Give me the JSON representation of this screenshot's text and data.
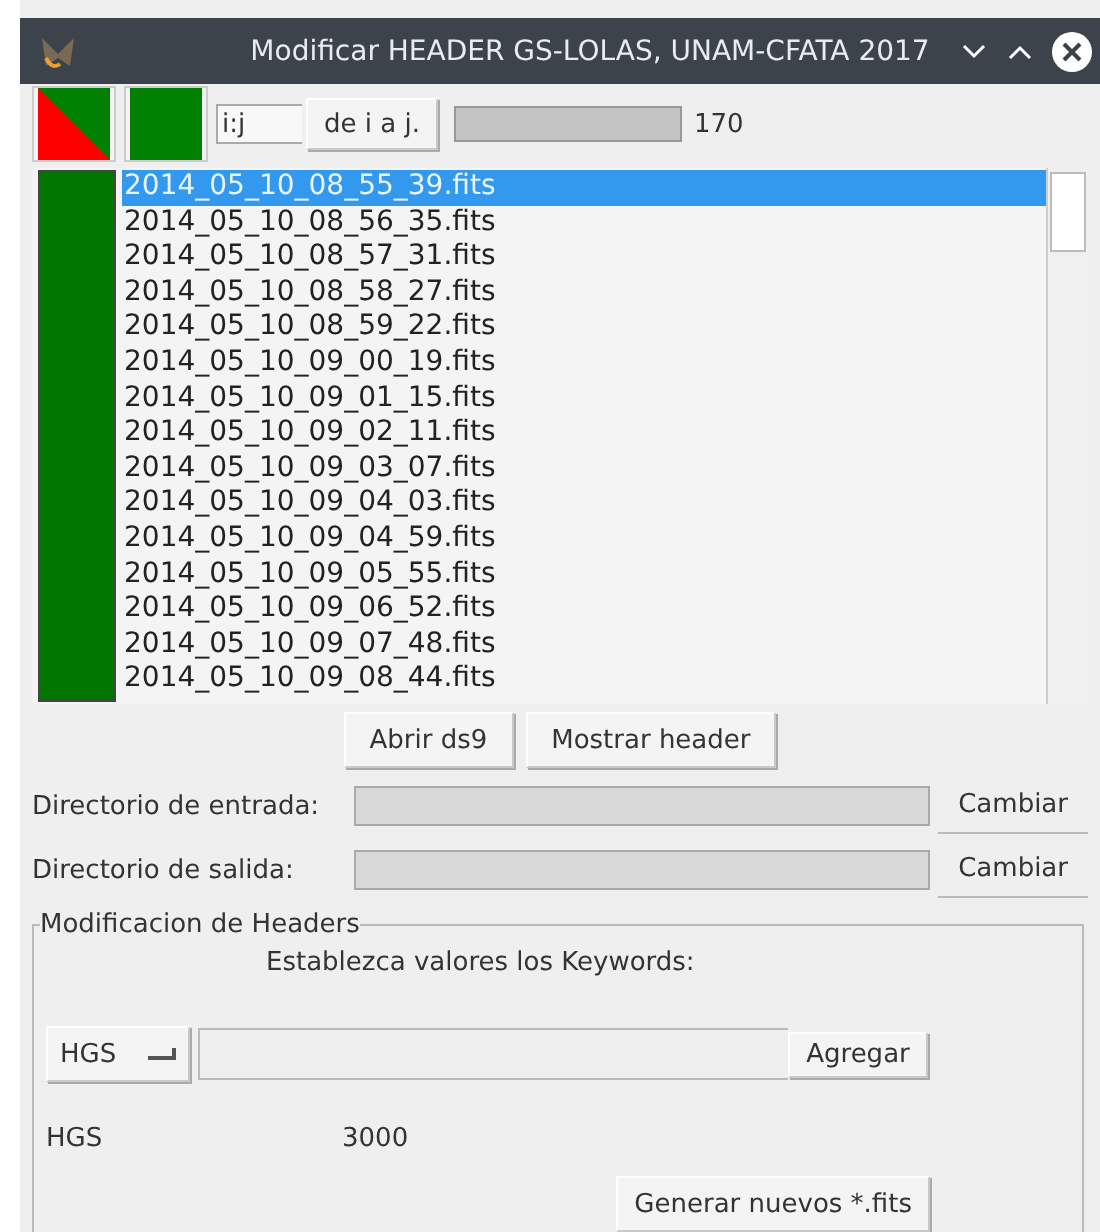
{
  "window": {
    "title": "Modificar HEADER GS-LOLAS, UNAM-CFATA 2017"
  },
  "toolbar": {
    "range_field": {
      "value": "i:j"
    },
    "range_button": "de i a j.",
    "progress": {
      "level": 1
    },
    "count": "170"
  },
  "files": [
    {
      "name": "2014_05_10_08_55_39.fits",
      "selected": true
    },
    {
      "name": "2014_05_10_08_56_35.fits",
      "selected": false
    },
    {
      "name": "2014_05_10_08_57_31.fits",
      "selected": false
    },
    {
      "name": "2014_05_10_08_58_27.fits",
      "selected": false
    },
    {
      "name": "2014_05_10_08_59_22.fits",
      "selected": false
    },
    {
      "name": "2014_05_10_09_00_19.fits",
      "selected": false
    },
    {
      "name": "2014_05_10_09_01_15.fits",
      "selected": false
    },
    {
      "name": "2014_05_10_09_02_11.fits",
      "selected": false
    },
    {
      "name": "2014_05_10_09_03_07.fits",
      "selected": false
    },
    {
      "name": "2014_05_10_09_04_03.fits",
      "selected": false
    },
    {
      "name": "2014_05_10_09_04_59.fits",
      "selected": false
    },
    {
      "name": "2014_05_10_09_05_55.fits",
      "selected": false
    },
    {
      "name": "2014_05_10_09_06_52.fits",
      "selected": false
    },
    {
      "name": "2014_05_10_09_07_48.fits",
      "selected": false
    },
    {
      "name": "2014_05_10_09_08_44.fits",
      "selected": false
    }
  ],
  "list_buttons": [
    "Abrir ds9",
    "Mostrar header"
  ],
  "directories": [
    {
      "label": "Directorio de entrada:",
      "button": "Cambiar",
      "disabled": true
    },
    {
      "label": "Directorio de salida:",
      "button": "Cambiar",
      "disabled": true
    }
  ],
  "headers_group": {
    "title": "Modificacion de Headers",
    "prompt": "Establezca valores los Keywords:",
    "keyword_menu": "HGS",
    "add_button": "Agregar",
    "entries": [
      {
        "keyword": "HGS",
        "value": "3000"
      }
    ],
    "generate_button": "Generar nuevos *.fits"
  }
}
